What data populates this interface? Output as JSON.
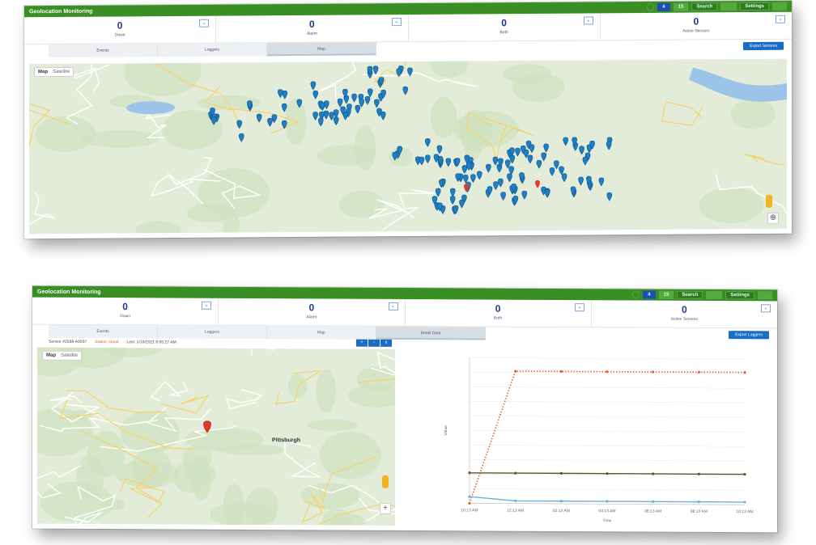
{
  "top_panel": {
    "header": {
      "title": "Geolocation Monitoring",
      "controls": [
        "4",
        "15",
        "Search",
        "",
        "Settings",
        ""
      ]
    },
    "stats": [
      {
        "value": "0",
        "label": "Down"
      },
      {
        "value": "0",
        "label": "Alarm"
      },
      {
        "value": "0",
        "label": "Both"
      },
      {
        "value": "0",
        "label": "Active Sensors"
      }
    ],
    "tabs": [
      "Events",
      "Loggers",
      "Map"
    ],
    "active_tab": "Map",
    "action_button": "Export Sensors",
    "map": {
      "type_selected": "Map",
      "type_other": "Satellite",
      "pin_count_blue": 230,
      "pin_color": "#1f7fc4"
    }
  },
  "bottom_panel": {
    "header": {
      "title": "Geolocation Monitoring",
      "controls": [
        "4",
        "15",
        "Search",
        "",
        "Settings",
        ""
      ]
    },
    "stats": [
      {
        "value": "0",
        "label": "Down"
      },
      {
        "value": "0",
        "label": "Alarm"
      },
      {
        "value": "0",
        "label": "Both"
      },
      {
        "value": "0",
        "label": "Active Sensors"
      }
    ],
    "tabs": [
      "Events",
      "Loggers",
      "Map",
      "Detail Data"
    ],
    "active_tab": "Detail Data",
    "action_button": "Export Loggers",
    "info_line": {
      "sensor": "Sensor #2568-A0037",
      "status": "Status: Good",
      "last": "Last: 1/15/2021 8:05:27 AM"
    },
    "map": {
      "type_selected": "Map",
      "type_other": "Satellite",
      "city_label": "Pittsburgh"
    },
    "map_buttons": [
      "+",
      "-",
      "x"
    ]
  },
  "chart_data": {
    "type": "line",
    "x": [
      "10:13 AM",
      "12:13 AM",
      "02:13 AM",
      "04:13 AM",
      "06:13 AM",
      "08:13 AM",
      "10:13 AM"
    ],
    "xlabel": "Time",
    "ylabel": "Value",
    "series": [
      {
        "name": "",
        "color": "#e8602a",
        "style": "dotted",
        "values": [
          0,
          100,
          100,
          100,
          100,
          100,
          100
        ]
      },
      {
        "name": "",
        "color": "#5a5530",
        "style": "solid",
        "values": [
          23,
          23,
          23,
          23,
          23,
          23,
          23
        ]
      },
      {
        "name": "",
        "color": "#6ab0e0",
        "style": "solid",
        "values": [
          5,
          2,
          2,
          2,
          2,
          2,
          2
        ]
      }
    ],
    "ylim": [
      0,
      110
    ],
    "grid": true
  }
}
